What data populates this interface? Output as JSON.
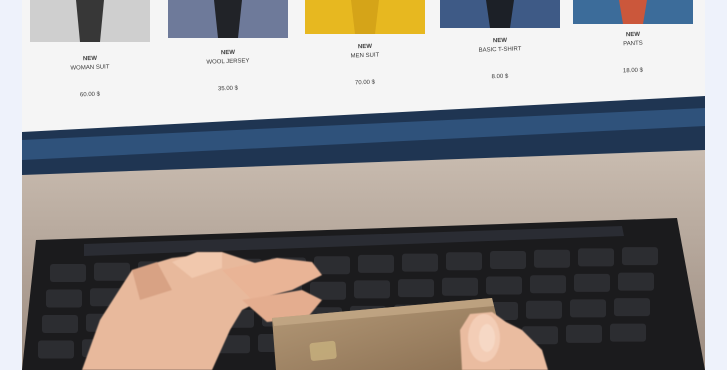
{
  "photo": {
    "subject": "Person shopping online on a laptop while holding a payment card",
    "icons": {
      "hands": "hands-icon",
      "card": "credit-card-icon",
      "keyboard": "keyboard-icon"
    },
    "colors": {
      "page_bg": "#eef2fb",
      "screen_bg": "#f5f5f5",
      "laptop_bezel": "#2a4a6e",
      "keyboard": "#1c1c1e",
      "laptop_body": "#b7a79a",
      "card": "#a08666",
      "skin": "#e8b99c"
    }
  },
  "products": [
    {
      "badge": "NEW",
      "name": "WOMAN SUIT",
      "price": "60.00 $",
      "color": "#cfcfcf",
      "accent": "#1c1c1c"
    },
    {
      "badge": "NEW",
      "name": "WOOL JERSEY",
      "price": "35.00 $",
      "color": "#6e7a9a",
      "accent": "#141414"
    },
    {
      "badge": "NEW",
      "name": "MEN SUIT",
      "price": "70.00 $",
      "color": "#e7b820",
      "accent": "#d1a017"
    },
    {
      "badge": "NEW",
      "name": "BASIC T-SHIRT",
      "price": "8.00 $",
      "color": "#3e5a86",
      "accent": "#161616"
    },
    {
      "badge": "NEW",
      "name": "PANTS",
      "price": "18.00 $",
      "color": "#3c6c9a",
      "accent": "#e4542a"
    }
  ]
}
